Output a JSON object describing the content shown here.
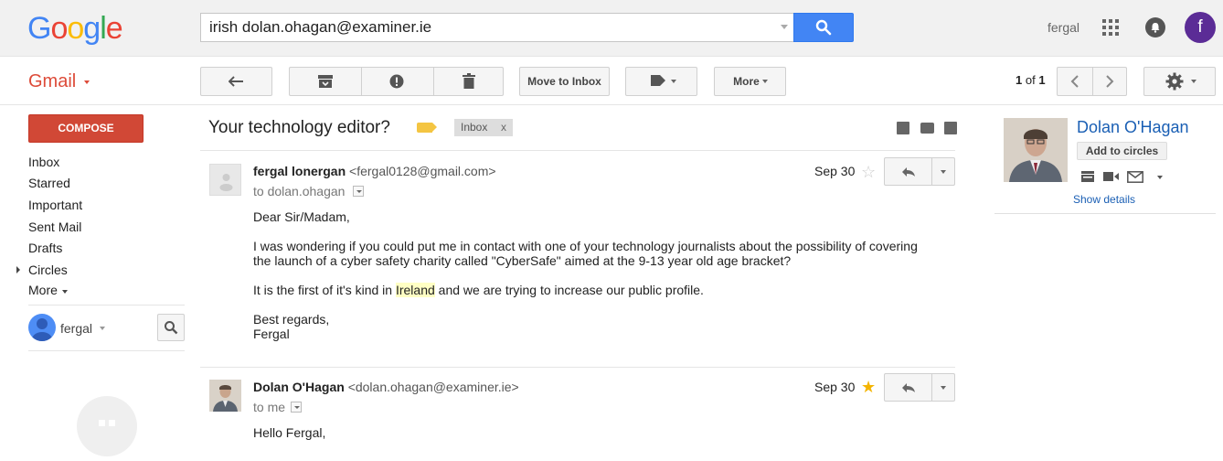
{
  "header": {
    "logo_text": "Google",
    "search_value": "irish dolan.ohagan@examiner.ie",
    "user_name": "fergal",
    "avatar_letter": "f"
  },
  "gmail": {
    "label": "Gmail"
  },
  "toolbar": {
    "move_to_inbox": "Move to Inbox",
    "more": "More",
    "page_current": "1",
    "page_of": "of",
    "page_total": "1"
  },
  "sidebar": {
    "compose": "COMPOSE",
    "items": [
      {
        "label": "Inbox"
      },
      {
        "label": "Starred"
      },
      {
        "label": "Important"
      },
      {
        "label": "Sent Mail"
      },
      {
        "label": "Drafts"
      },
      {
        "label": "Circles"
      },
      {
        "label": "More"
      }
    ],
    "chat_user": "fergal"
  },
  "thread": {
    "subject": "Your technology editor?",
    "label_chip": "Inbox",
    "label_chip_close": "x",
    "messages": [
      {
        "sender_name": "fergal lonergan",
        "sender_email": "<fergal0128@gmail.com>",
        "to": "to dolan.ohagan",
        "date": "Sep 30",
        "starred": false,
        "greeting": "Dear Sir/Madam,",
        "p1": "I was wondering if you could put me in contact with one of your technology journalists about the possibility of covering",
        "p1b": "the launch of a cyber safety charity called \"CyberSafe\" aimed at the 9-13 year old age bracket?",
        "p2a": "It is the first of it's kind in ",
        "p2hl": "Ireland",
        "p2b": " and we are trying to increase our public profile.",
        "closing": "Best regards,",
        "signature": "Fergal"
      },
      {
        "sender_name": "Dolan O'Hagan",
        "sender_email": "<dolan.ohagan@examiner.ie>",
        "to": "to me",
        "date": "Sep 30",
        "starred": true,
        "greeting": "Hello Fergal,"
      }
    ]
  },
  "contact": {
    "name": "Dolan O'Hagan",
    "add_to_circles": "Add to circles",
    "show_details": "Show details"
  },
  "colors": {
    "search_blue": "#4285f4",
    "compose_red": "#d14836",
    "gmail_red": "#dd4b39",
    "star_yellow": "#f4b400",
    "link_blue": "#1a5fb4"
  }
}
